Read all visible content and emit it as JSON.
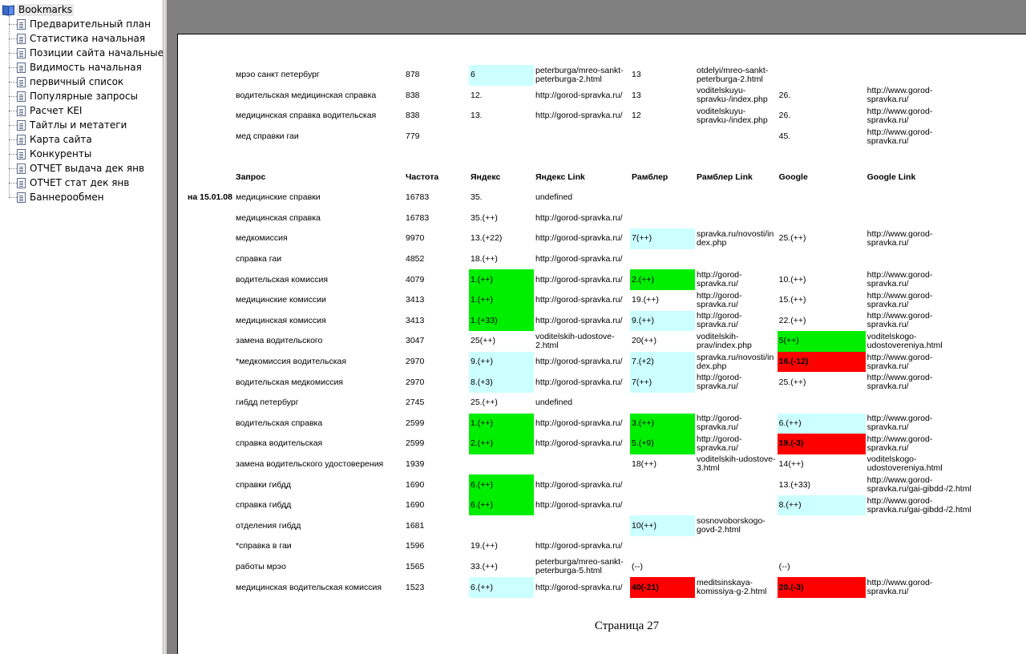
{
  "bookmarks": {
    "root_label": "Bookmarks",
    "items": [
      "Предварительный план",
      "Статистика начальная",
      "Позиции сайта начальные",
      "Видимость начальная",
      "первичный список",
      "Популярные запросы",
      "Расчет KEI",
      "Тайтлы и метатеги",
      "Карта сайта",
      "Конкуренты",
      "ОТЧЕТ выдача дек янв",
      "ОТЧЕТ стат дек янв",
      "Баннерообмен"
    ]
  },
  "report": {
    "top_rows": [
      {
        "query": "мрэо санкт петербург",
        "freq": "878",
        "yandex": "6",
        "ylink": "peterburga/mreo-sankt-\npeterburga-2.html",
        "rambler": "13",
        "rlink": "otdelyi/mreo-sankt-\npeterburga-2.html",
        "google": "",
        "glink": ""
      },
      {
        "query": "водительская медицинская справка",
        "freq": "838",
        "yandex": "12.",
        "ylink": "http://gorod-spravka.ru/",
        "rambler": "13",
        "rlink": "voditelskuyu-\nspravku-/index.php",
        "google": "26.",
        "glink": "http://www.gorod-\nspravka.ru/"
      },
      {
        "query": "медицинская справка водительская",
        "freq": "838",
        "yandex": "13.",
        "ylink": "http://gorod-spravka.ru/",
        "rambler": "12",
        "rlink": "voditelskuyu-\nspravku-/index.php",
        "google": "26.",
        "glink": "http://www.gorod-\nspravka.ru/"
      },
      {
        "query": "мед справки гаи",
        "freq": "779",
        "yandex": "",
        "ylink": "",
        "rambler": "",
        "rlink": "",
        "google": "45.",
        "glink": "http://www.gorod-\nspravka.ru/"
      }
    ],
    "headers": [
      "Запрос",
      "Частота",
      "Яндекс",
      "Яндекс Link",
      "Рамблер",
      "Рамблер Link",
      "Google",
      "Google Link"
    ],
    "date_label": "на 15.01.08",
    "rows": [
      {
        "query": "медицинские справки",
        "freq": "16783",
        "yandex": "35.",
        "ylink": "undefined",
        "rambler": "",
        "rlink": "",
        "google": "",
        "glink": ""
      },
      {
        "query": "медицинская справка",
        "freq": "16783",
        "yandex": "35.(++)",
        "ylink": "http://gorod-spravka.ru/",
        "rambler": "",
        "rlink": "",
        "google": "",
        "glink": ""
      },
      {
        "query": "медкомиссия",
        "freq": "9970",
        "yandex": "13.(+22)",
        "ylink": "http://gorod-spravka.ru/",
        "rambler": "7(++)",
        "rlink": "spravka.ru/novosti/in\ndex.php",
        "google": "25.(++)",
        "glink": "http://www.gorod-\nspravka.ru/"
      },
      {
        "query": "справка гаи",
        "freq": "4852",
        "yandex": "18.(++)",
        "ylink": "http://gorod-spravka.ru/",
        "rambler": "",
        "rlink": "",
        "google": "",
        "glink": ""
      },
      {
        "query": "водительская комиссия",
        "freq": "4079",
        "yandex": "1.(++)",
        "ylink": "http://gorod-spravka.ru/",
        "rambler": "2.(++)",
        "rlink": "http://gorod-\nspravka.ru/",
        "google": "10.(++)",
        "glink": "http://www.gorod-\nspravka.ru/"
      },
      {
        "query": "медицинские комиссии",
        "freq": "3413",
        "yandex": "1.(++)",
        "ylink": "http://gorod-spravka.ru/",
        "rambler": "19.(++)",
        "rlink": "http://gorod-\nspravka.ru/",
        "google": "15.(++)",
        "glink": "http://www.gorod-\nspravka.ru/"
      },
      {
        "query": "медицинская комиссия",
        "freq": "3413",
        "yandex": "1.(+33)",
        "ylink": "http://gorod-spravka.ru/",
        "rambler": "9.(++)",
        "rlink": "http://gorod-\nspravka.ru/",
        "google": "22.(++)",
        "glink": "http://www.gorod-\nspravka.ru/"
      },
      {
        "query": "замена водительского",
        "freq": "3047",
        "yandex": "25(++)",
        "ylink": "voditelskih-udostove-\n2.html",
        "rambler": "20(++)",
        "rlink": "voditelskih-\nprav/index.php",
        "google": "5(++)",
        "glink": "voditelskogo-\nudostovereniya.html"
      },
      {
        "query": "*медкомиссия водительская",
        "freq": "2970",
        "yandex": "9.(++)",
        "ylink": "http://gorod-spravka.ru/",
        "rambler": "7.(+2)",
        "rlink": "spravka.ru/novosti/in\ndex.php",
        "google": "16.(-12)",
        "glink": "http://www.gorod-\nspravka.ru/"
      },
      {
        "query": "водительская медкомиссия",
        "freq": "2970",
        "yandex": "8.(+3)",
        "ylink": "http://gorod-spravka.ru/",
        "rambler": "7(++)",
        "rlink": "http://gorod-\nspravka.ru/",
        "google": "25.(++)",
        "glink": "http://www.gorod-\nspravka.ru/"
      },
      {
        "query": "гибдд петербург",
        "freq": "2745",
        "yandex": "25.(++)",
        "ylink": "undefined",
        "rambler": "",
        "rlink": "",
        "google": "",
        "glink": ""
      },
      {
        "query": "водительская справка",
        "freq": "2599",
        "yandex": "1.(++)",
        "ylink": "http://gorod-spravka.ru/",
        "rambler": "3.(++)",
        "rlink": "http://gorod-\nspravka.ru/",
        "google": "6.(++)",
        "glink": "http://www.gorod-\nspravka.ru/"
      },
      {
        "query": "справка водительская",
        "freq": "2599",
        "yandex": "2.(++)",
        "ylink": "http://gorod-spravka.ru/",
        "rambler": "5.(+9)",
        "rlink": "http://gorod-\nspravka.ru/",
        "google": "19.(-3)",
        "glink": "http://www.gorod-\nspravka.ru/"
      },
      {
        "query": "замена водительского удостоверения",
        "freq": "1939",
        "yandex": "",
        "ylink": "",
        "rambler": "18(++)",
        "rlink": "voditelskih-udostove-\n3.html",
        "google": "14(++)",
        "glink": "voditelskogo-\nudostovereniya.html"
      },
      {
        "query": "справки гибдд",
        "freq": "1690",
        "yandex": "6.(++)",
        "ylink": "http://gorod-spravka.ru/",
        "rambler": "",
        "rlink": "",
        "google": "13.(+33)",
        "glink": "http://www.gorod-\nspravka.ru/gai-gibdd-/2.html"
      },
      {
        "query": "справка гибдд",
        "freq": "1690",
        "yandex": "6.(++)",
        "ylink": "http://gorod-spravka.ru/",
        "rambler": "",
        "rlink": "",
        "google": "8.(++)",
        "glink": "http://www.gorod-\nspravka.ru/gai-gibdd-/2.html"
      },
      {
        "query": "отделения гибдд",
        "freq": "1681",
        "yandex": "",
        "ylink": "",
        "rambler": "10(++)",
        "rlink": "sosnovoborskogo-\ngovd-2.html",
        "google": "",
        "glink": ""
      },
      {
        "query": "*справка в гаи",
        "freq": "1596",
        "yandex": "19.(++)",
        "ylink": "http://gorod-spravka.ru/",
        "rambler": "",
        "rlink": "",
        "google": "",
        "glink": ""
      },
      {
        "query": "работы мрэо",
        "freq": "1565",
        "yandex": "33.(++)",
        "ylink": "peterburga/mreo-sankt-\npeterburga-5.html",
        "rambler": "(--)",
        "rlink": "",
        "google": "(--)",
        "glink": ""
      },
      {
        "query": "медицинская водительская комиссия",
        "freq": "1523",
        "yandex": "6.(++)",
        "ylink": "http://gorod-spravka.ru/",
        "rambler": "40(-21)",
        "rlink": "meditsinskaya-\nkomissiya-g-2.html",
        "google": "20.(-3)",
        "glink": "http://www.gorod-\nspravka.ru/"
      }
    ],
    "page_label": "Страница 27",
    "colors": {
      "cyan": "#ccffff",
      "green": "#00ee00",
      "red": "#ff0000"
    }
  }
}
